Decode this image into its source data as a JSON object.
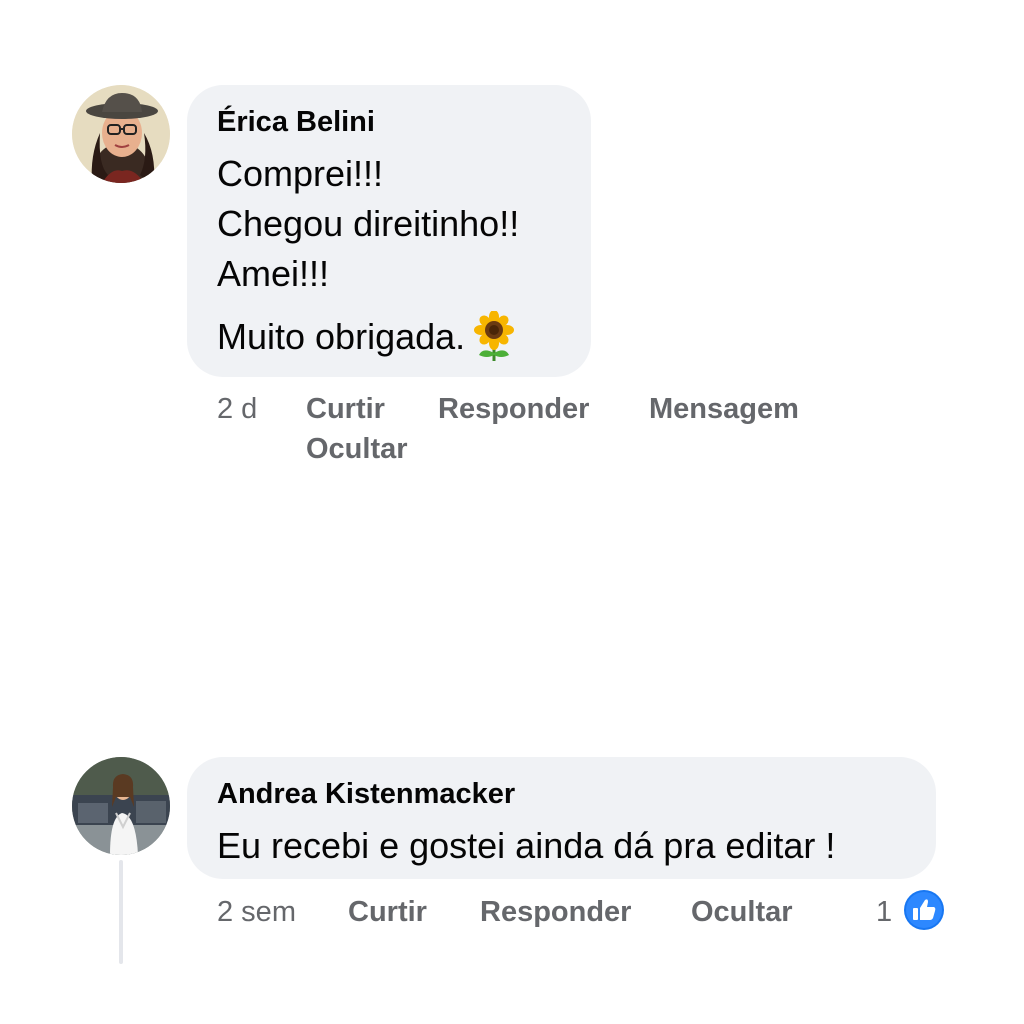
{
  "comments": [
    {
      "author": "Érica Belini",
      "lines": [
        "Comprei!!!",
        "Chegou direitinho!!",
        "Amei!!!",
        "Muito obrigada."
      ],
      "emoji": "sunflower",
      "time": "2 d",
      "actions": [
        "Curtir",
        "Responder",
        "Mensagem",
        "Ocultar"
      ]
    },
    {
      "author": "Andrea Kistenmacker",
      "lines": [
        "Eu recebi e gostei ainda dá pra editar !"
      ],
      "time": "2 sem",
      "actions": [
        "Curtir",
        "Responder",
        "Ocultar"
      ],
      "reaction_count": "1",
      "reaction_icon": "like-icon"
    }
  ],
  "colors": {
    "bubble": "#f0f2f5",
    "text": "#050505",
    "secondary": "#65676b",
    "like_blue": "#1877f2"
  }
}
